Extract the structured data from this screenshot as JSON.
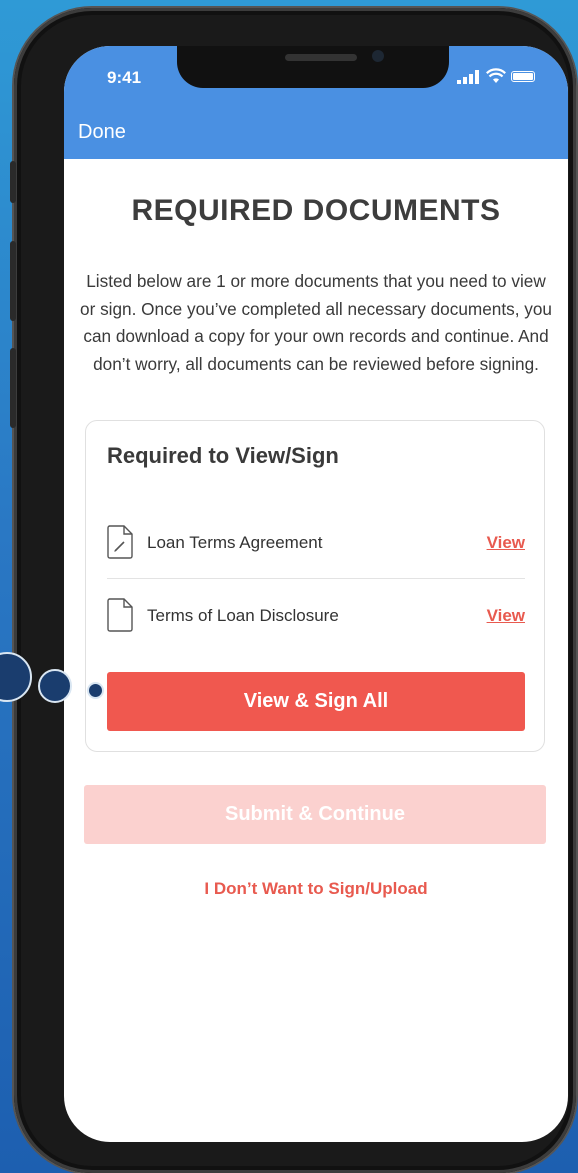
{
  "status_bar": {
    "time": "9:41"
  },
  "nav": {
    "done_label": "Done"
  },
  "page": {
    "title": "REQUIRED DOCUMENTS",
    "description": "Listed below are 1 or more documents that you need to view or sign. Once you’ve completed all necessary documents, you can download a copy for your own records and continue. And don’t worry, all documents can be reviewed before signing."
  },
  "card": {
    "title": "Required to View/Sign",
    "documents": [
      {
        "name": "Loan Terms Agreement",
        "action": "View",
        "icon": "document-sign-icon"
      },
      {
        "name": "Terms of Loan Disclosure",
        "action": "View",
        "icon": "document-icon"
      }
    ],
    "primary_button": "View & Sign All"
  },
  "actions": {
    "submit_label": "Submit & Continue",
    "decline_label": "I Don’t Want to Sign/Upload"
  },
  "colors": {
    "header_blue": "#4a90e2",
    "accent_red": "#f0584f",
    "disabled_pink": "#fbd1cf"
  }
}
